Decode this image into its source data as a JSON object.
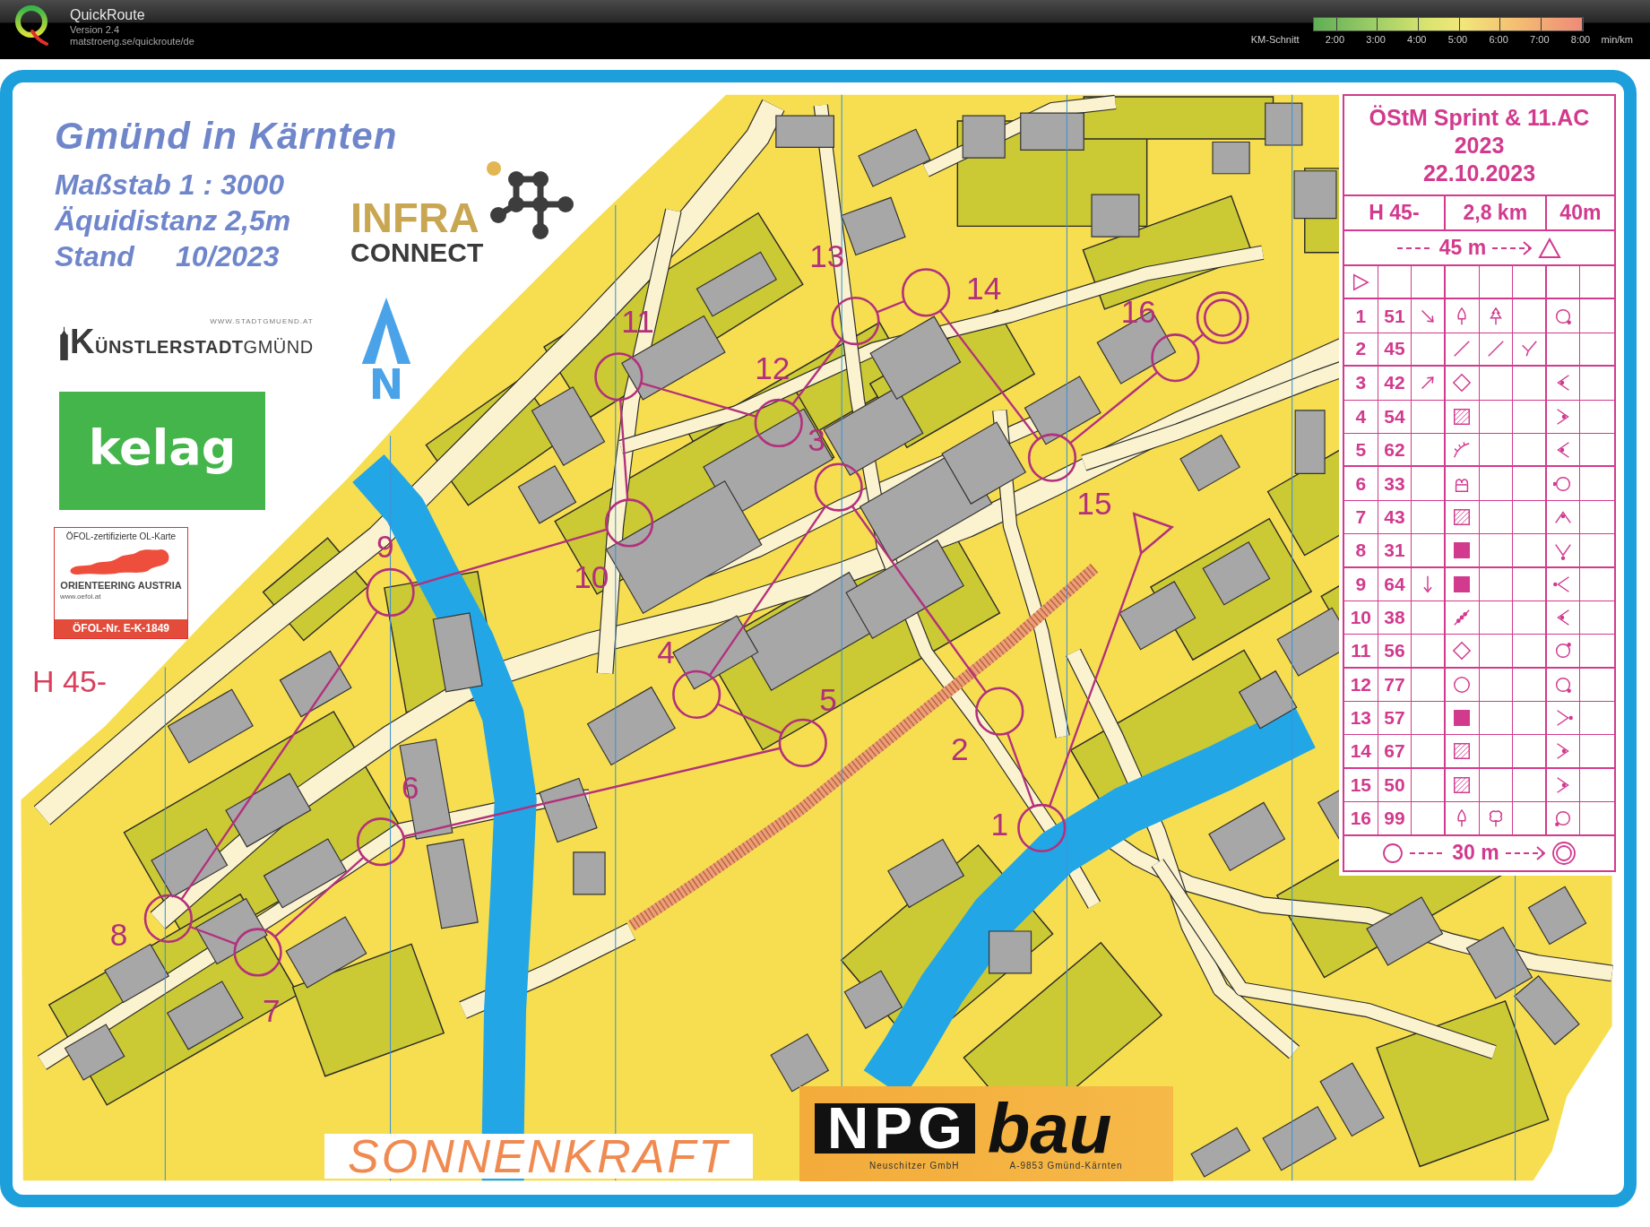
{
  "app_bar": {
    "title": "QuickRoute",
    "version": "Version 2.4",
    "url": "matstroeng.se/quickroute/de",
    "pace_label": "KM-Schnitt",
    "pace_ticks": [
      "2:00",
      "3:00",
      "4:00",
      "5:00",
      "6:00",
      "7:00",
      "8:00"
    ],
    "pace_unit": "min/km"
  },
  "map_header": {
    "title": "Gmünd in Kärnten",
    "scale": "Maßstab 1 : 3000",
    "contour_interval": "Äquidistanz 2,5m",
    "revision_label": "Stand",
    "revision_date": "10/2023"
  },
  "sponsor_logos": {
    "infra": "INFRA",
    "connect": "CONNECT",
    "town_url": "WWW.STADTGMUEND.AT",
    "town_name": "K**ÜNSTLERSTADT**GMÜND",
    "kelag": "kelag",
    "oefol_heading": "ÖFOL-zertifizierte OL-Karte",
    "oefol_name": "ORIENTEERING AUSTRIA",
    "oefol_url": "www.oefol.at",
    "oefol_number": "ÖFOL-Nr. E-K-1849",
    "sonnenkraft": "SONNENKRAFT",
    "npg": "NPG",
    "bau": "bau",
    "npg_company": "Neuschitzer GmbH",
    "npg_address": "A-9853 Gmünd-Kärnten"
  },
  "north_arrow": {
    "letter": "N"
  },
  "course_label": "H 45-",
  "course": {
    "controls": [
      {
        "number": "1"
      },
      {
        "number": "2"
      },
      {
        "number": "3"
      },
      {
        "number": "4"
      },
      {
        "number": "5"
      },
      {
        "number": "6"
      },
      {
        "number": "7"
      },
      {
        "number": "8"
      },
      {
        "number": "9"
      },
      {
        "number": "10"
      },
      {
        "number": "11"
      },
      {
        "number": "12"
      },
      {
        "number": "13"
      },
      {
        "number": "14"
      },
      {
        "number": "15"
      },
      {
        "number": "16"
      }
    ]
  },
  "description_sheet": {
    "event_lines": [
      "ÖStM Sprint & 11.AC",
      "2023",
      "22.10.2023"
    ],
    "class": "H 45-",
    "length": "2,8 km",
    "climb": "40m",
    "start_distance": "45 m",
    "controls": [
      {
        "number": "1",
        "code": "51",
        "which": {
          "kind": "arrow-se"
        },
        "feature": {
          "kind": "tree"
        },
        "appearance": {
          "kind": "conifer"
        },
        "location": {
          "kind": "side-se"
        }
      },
      {
        "number": "2",
        "code": "45",
        "feature": {
          "kind": "line"
        },
        "appearance": {
          "kind": "line"
        },
        "combination": {
          "kind": "junction"
        }
      },
      {
        "number": "3",
        "code": "42",
        "which": {
          "kind": "arrow-ne"
        },
        "feature": {
          "kind": "diamond"
        },
        "location": {
          "kind": "corner-w-in"
        }
      },
      {
        "number": "4",
        "code": "54",
        "feature": {
          "kind": "hatched"
        },
        "location": {
          "kind": "corner-e-in"
        }
      },
      {
        "number": "5",
        "code": "62",
        "feature": {
          "kind": "bank"
        },
        "location": {
          "kind": "corner-w-in"
        }
      },
      {
        "number": "6",
        "code": "33",
        "feature": {
          "kind": "loops-box"
        },
        "location": {
          "kind": "side-w"
        }
      },
      {
        "number": "7",
        "code": "43",
        "feature": {
          "kind": "hatched"
        },
        "location": {
          "kind": "corner-n-in"
        }
      },
      {
        "number": "8",
        "code": "31",
        "feature": {
          "kind": "solid"
        },
        "location": {
          "kind": "corner-s-out"
        }
      },
      {
        "number": "9",
        "code": "64",
        "which": {
          "kind": "arrow-s"
        },
        "feature": {
          "kind": "solid"
        },
        "location": {
          "kind": "corner-w-out"
        }
      },
      {
        "number": "10",
        "code": "38",
        "feature": {
          "kind": "dotted-line"
        },
        "location": {
          "kind": "corner-w-in"
        }
      },
      {
        "number": "11",
        "code": "56",
        "feature": {
          "kind": "diamond"
        },
        "location": {
          "kind": "side-ne"
        }
      },
      {
        "number": "12",
        "code": "77",
        "feature": {
          "kind": "circle"
        },
        "location": {
          "kind": "side-se"
        }
      },
      {
        "number": "13",
        "code": "57",
        "feature": {
          "kind": "solid"
        },
        "location": {
          "kind": "corner-e-out"
        }
      },
      {
        "number": "14",
        "code": "67",
        "feature": {
          "kind": "hatched"
        },
        "location": {
          "kind": "corner-e-in"
        }
      },
      {
        "number": "15",
        "code": "50",
        "feature": {
          "kind": "hatched"
        },
        "location": {
          "kind": "corner-e-in"
        }
      },
      {
        "number": "16",
        "code": "99",
        "feature": {
          "kind": "tree"
        },
        "appearance": {
          "kind": "broadleaf"
        },
        "location": {
          "kind": "side-sw"
        }
      }
    ],
    "finish_distance": "30 m"
  }
}
